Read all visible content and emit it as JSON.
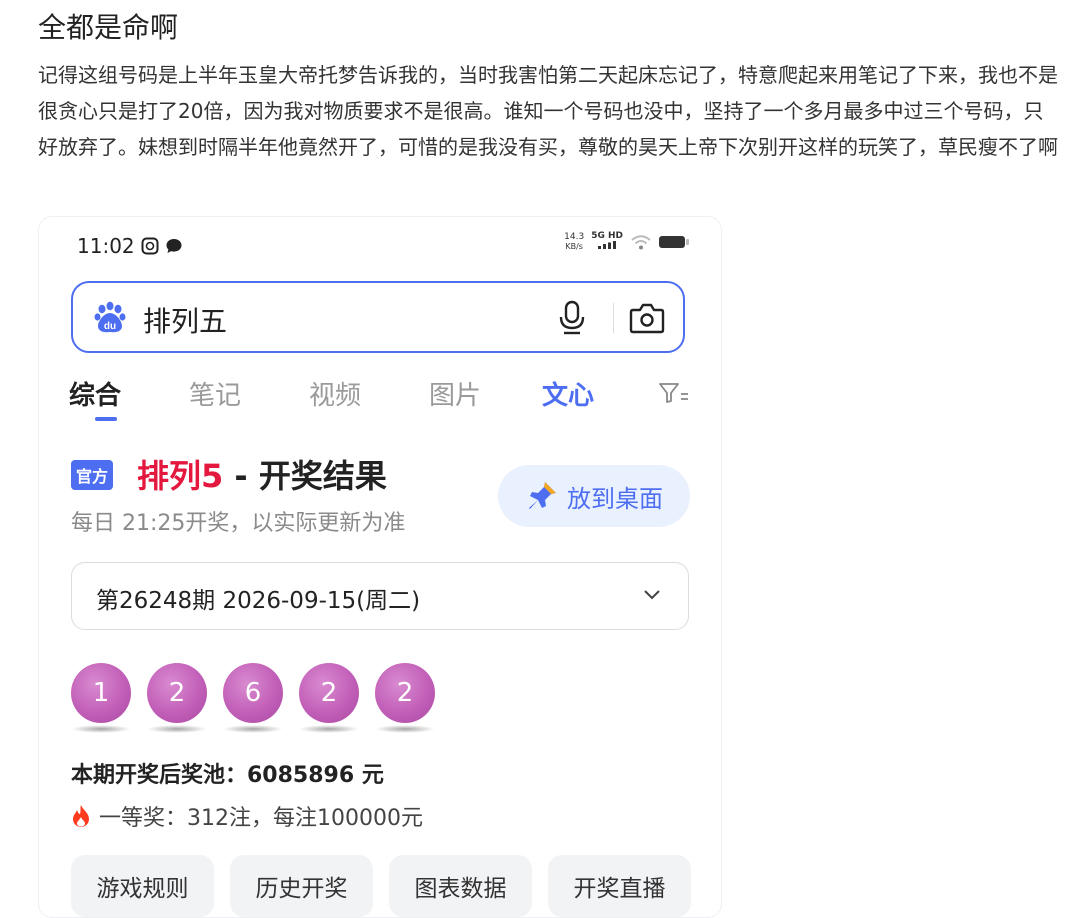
{
  "post": {
    "title": "全都是命啊",
    "body": "记得这组号码是上半年玉皇大帝托梦告诉我的，当时我害怕第二天起床忘记了，特意爬起来用笔记了下来，我也不是很贪心只是打了20倍，因为我对物质要求不是很高。谁知一个号码也没中，坚持了一个多月最多中过三个号码，只好放弃了。妹想到时隔半年他竟然开了，可惜的是我没有买，尊敬的昊天上帝下次别开这样的玩笑了，草民瘦不了啊"
  },
  "status_bar": {
    "time": "11:02",
    "net_speed_value": "14.3",
    "net_speed_unit": "KB/s",
    "signal_label": "5G HD"
  },
  "search": {
    "query": "排列五",
    "logo_icon": "baidu-paw-icon",
    "voice_icon": "microphone-icon",
    "camera_icon": "camera-icon"
  },
  "tabs": [
    {
      "label": "综合",
      "active": true
    },
    {
      "label": "笔记"
    },
    {
      "label": "视频"
    },
    {
      "label": "图片"
    },
    {
      "label": "文心"
    }
  ],
  "result": {
    "badge": "官方",
    "title_red": "排列5",
    "title_rest": " - 开奖结果",
    "schedule": "每日 21:25开奖，以实际更新为准",
    "desktop_button": "放到桌面",
    "period": "第26248期 2026-09-15(周二)",
    "numbers": [
      "1",
      "2",
      "6",
      "2",
      "2"
    ],
    "pool": "本期开奖后奖池：6085896 元",
    "first_prize": "一等奖：312注，每注100000元",
    "buttons": [
      "游戏规则",
      "历史开奖",
      "图表数据",
      "开奖直播"
    ]
  },
  "colors": {
    "accent": "#4e6ef2",
    "red": "#e4173f",
    "ball": "#c25fb8"
  }
}
